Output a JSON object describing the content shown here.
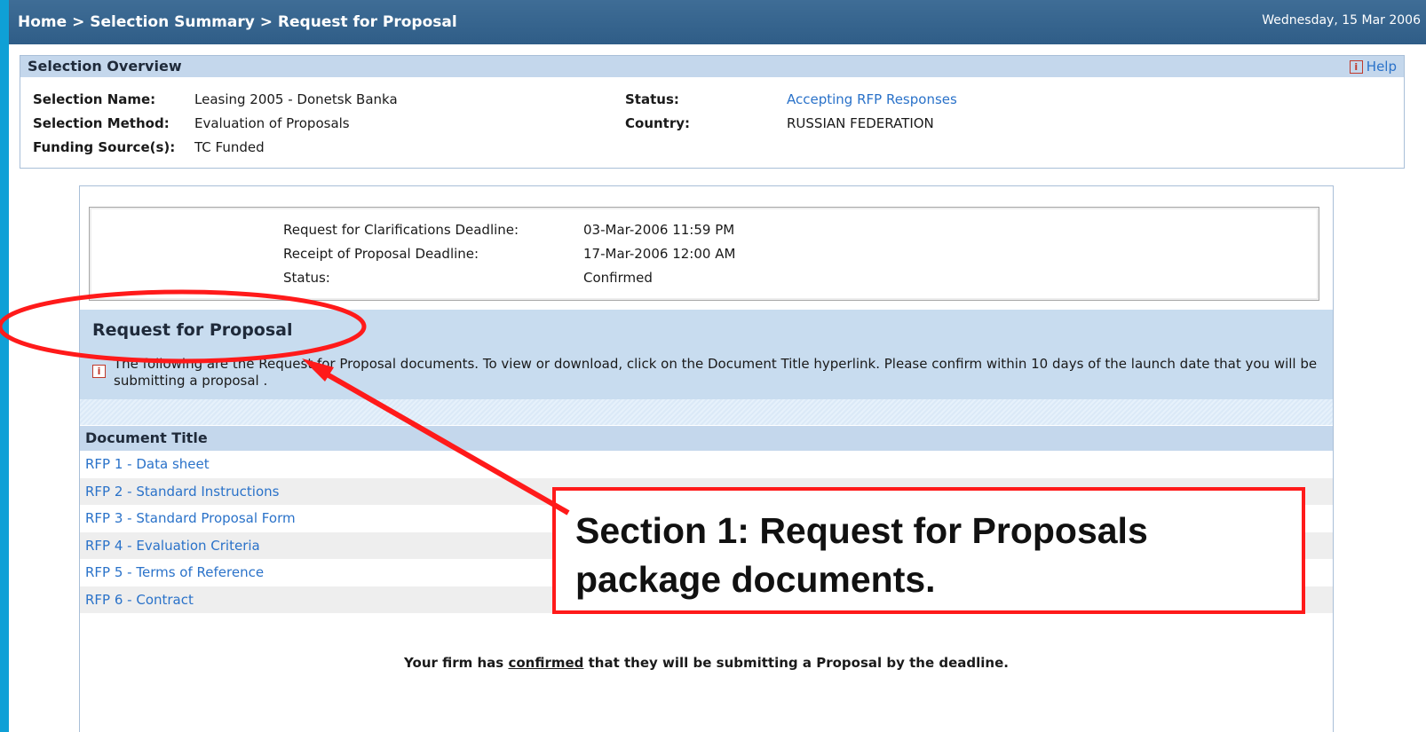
{
  "header": {
    "breadcrumb": [
      "Home",
      "Selection Summary",
      "Request for Proposal"
    ],
    "separator": ">",
    "date": "Wednesday, 15 Mar 2006"
  },
  "overview": {
    "title": "Selection Overview",
    "help_label": "Help",
    "help_icon": "info-icon",
    "fields_left": [
      {
        "label": "Selection Name:",
        "value": "Leasing 2005 - Donetsk Banka"
      },
      {
        "label": "Selection Method:",
        "value": "Evaluation of Proposals"
      },
      {
        "label": "Funding Source(s):",
        "value": "TC Funded"
      }
    ],
    "fields_right": [
      {
        "label": "Status:",
        "value": "Accepting RFP Responses"
      },
      {
        "label": "Country:",
        "value": "RUSSIAN FEDERATION"
      }
    ]
  },
  "deadlines": [
    {
      "label": "Request for Clarifications Deadline:",
      "value": "03-Mar-2006 11:59 PM"
    },
    {
      "label": "Receipt of Proposal Deadline:",
      "value": "17-Mar-2006 12:00 AM"
    },
    {
      "label": "Status:",
      "value": "Confirmed"
    }
  ],
  "rfp": {
    "title": "Request for Proposal",
    "description": "The following are the Request for Proposal documents. To view or download, click on the Document Title hyperlink. Please confirm within 10 days of the launch date that you will be submitting a proposal ."
  },
  "documents": {
    "header": "Document Title",
    "items": [
      "RFP 1 - Data sheet",
      "RFP 2 - Standard Instructions",
      "RFP 3 - Standard Proposal Form",
      "RFP 4 - Evaluation Criteria",
      "RFP 5 - Terms of Reference",
      "RFP 6 - Contract"
    ]
  },
  "confirmation": {
    "before": "Your firm has ",
    "emph": "confirmed",
    "after": " that they will be submitting a Proposal by the deadline."
  },
  "annotation": {
    "callout_lines": [
      "Section 1: Request for Proposals",
      "package documents."
    ],
    "color": "#ff1a1a"
  },
  "colors": {
    "frame": "#0fa0d6",
    "header_bar": "#36648e",
    "link": "#2a72c9",
    "section_band": "#c8dcef"
  }
}
